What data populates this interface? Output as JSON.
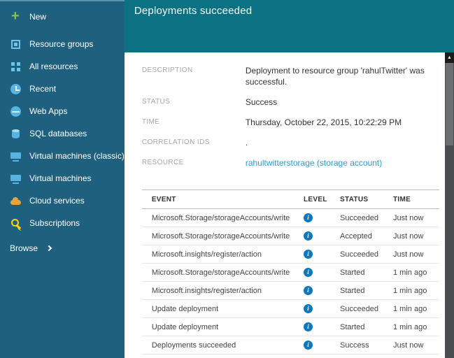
{
  "header": {
    "title": "Deployments succeeded"
  },
  "sidebar": {
    "new": {
      "label": "New"
    },
    "items": [
      {
        "label": "Resource groups",
        "icon": "resource-groups"
      },
      {
        "label": "All resources",
        "icon": "all-resources"
      },
      {
        "label": "Recent",
        "icon": "recent"
      },
      {
        "label": "Web Apps",
        "icon": "web-apps"
      },
      {
        "label": "SQL databases",
        "icon": "sql-databases"
      },
      {
        "label": "Virtual machines (classic)",
        "icon": "vm-classic"
      },
      {
        "label": "Virtual machines",
        "icon": "vm"
      },
      {
        "label": "Cloud services",
        "icon": "cloud-services"
      },
      {
        "label": "Subscriptions",
        "icon": "subscriptions"
      }
    ],
    "browse": {
      "label": "Browse"
    }
  },
  "details": {
    "fields": [
      {
        "label": "DESCRIPTION",
        "value": "Deployment to resource group 'rahulTwitter' was successful.",
        "link": false
      },
      {
        "label": "STATUS",
        "value": "Success",
        "link": false
      },
      {
        "label": "TIME",
        "value": "Thursday, October 22, 2015, 10:22:29 PM",
        "link": false
      },
      {
        "label": "CORRELATION IDS",
        "value": ".",
        "link": false
      },
      {
        "label": "RESOURCE",
        "value": "rahultwitterstorage (storage account)",
        "link": true
      }
    ]
  },
  "events": {
    "headers": {
      "event": "EVENT",
      "level": "LEVEL",
      "status": "STATUS",
      "time": "TIME"
    },
    "rows": [
      {
        "event": "Microsoft.Storage/storageAccounts/write",
        "status": "Succeeded",
        "time": "Just now"
      },
      {
        "event": "Microsoft.Storage/storageAccounts/write",
        "status": "Accepted",
        "time": "Just now"
      },
      {
        "event": "Microsoft.insights/register/action",
        "status": "Succeeded",
        "time": "Just now"
      },
      {
        "event": "Microsoft.Storage/storageAccounts/write",
        "status": "Started",
        "time": "1 min ago"
      },
      {
        "event": "Microsoft.insights/register/action",
        "status": "Started",
        "time": "1 min ago"
      },
      {
        "event": "Update deployment",
        "status": "Succeeded",
        "time": "1 min ago"
      },
      {
        "event": "Update deployment",
        "status": "Started",
        "time": "1 min ago"
      },
      {
        "event": "Deployments succeeded",
        "status": "Success",
        "time": "Just now"
      }
    ]
  },
  "colors": {
    "sidebar_bg": "#20607f",
    "header_bg": "#0d7184",
    "link": "#2e9bd6",
    "info_icon": "#0b79bf",
    "new_plus_green": "#8bc540"
  }
}
